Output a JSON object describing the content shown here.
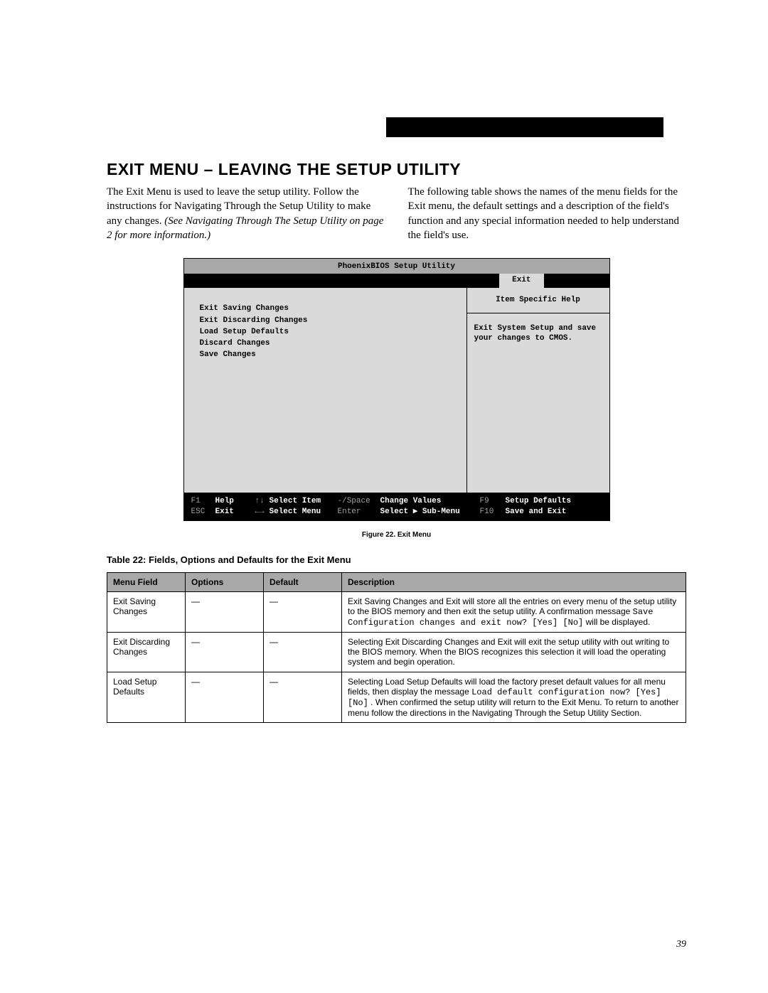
{
  "sectionTitle": "EXIT MENU – LEAVING THE SETUP UTILITY",
  "intro": {
    "left_a": "The Exit Menu is used to leave the setup utility. Follow the instructions for Navigating Through the Setup Utility to make any changes. ",
    "left_b": "(See Navigating Through The Setup Utility on page 2 for more information.)",
    "right": "The following table shows the names of the menu fields for the Exit menu, the default settings and a description of the field's function and any special information needed to help understand the field's use."
  },
  "bios": {
    "title": "PhoenixBIOS Setup Utility",
    "activeTab": "Exit",
    "items": [
      "Exit Saving Changes",
      "Exit Discarding Changes",
      "Load Setup Defaults",
      "Discard Changes",
      "Save Changes"
    ],
    "helpTitle": "Item Specific Help",
    "helpBody": "Exit System Setup and save your changes to CMOS.",
    "footer": {
      "r1": {
        "k1": "F1",
        "v1": "Help",
        "arr1": "↑↓",
        "v2": "Select Item",
        "k2": "-/Space",
        "v3": "Change Values",
        "k3": "F9",
        "v4": "Setup Defaults"
      },
      "r2": {
        "k1": "ESC",
        "v1": "Exit",
        "arr1": "←→",
        "v2": "Select Menu",
        "k2": "Enter",
        "v3": "Select ▶ Sub-Menu",
        "k3": "F10",
        "v4": "Save and Exit"
      }
    }
  },
  "figureCaption": "Figure 22.  Exit Menu",
  "tableCaption": "Table 22: Fields, Options and Defaults for the Exit Menu",
  "table": {
    "headers": [
      "Menu Field",
      "Options",
      "Default",
      "Description"
    ],
    "rows": [
      {
        "field": "Exit Saving Changes",
        "options": "—",
        "default": "—",
        "desc_a": "Exit Saving Changes and Exit will store all the entries on every menu of the setup utility to the BIOS memory and then exit the setup utility. A confirmation message ",
        "desc_code1": "Save Configuration changes and exit now? [Yes] [No]",
        "desc_b": " will be displayed."
      },
      {
        "field": "Exit Discarding Changes",
        "options": "—",
        "default": "—",
        "desc_a": "Selecting Exit Discarding Changes and Exit will exit the setup utility with out writing to the BIOS memory. When the BIOS recognizes this selection it will load the operating system and begin operation.",
        "desc_code1": "",
        "desc_b": ""
      },
      {
        "field": "Load Setup Defaults",
        "options": "—",
        "default": "—",
        "desc_a": "Selecting Load Setup Defaults will load the factory preset default values for all menu fields, then display the message ",
        "desc_code1": "Load default configuration now? [Yes] [No]",
        "desc_b": ". When confirmed the setup utility will return to the Exit Menu. To return to another menu follow the directions in the Navigating Through the Setup Utility Section."
      }
    ]
  },
  "pageNumber": "39"
}
